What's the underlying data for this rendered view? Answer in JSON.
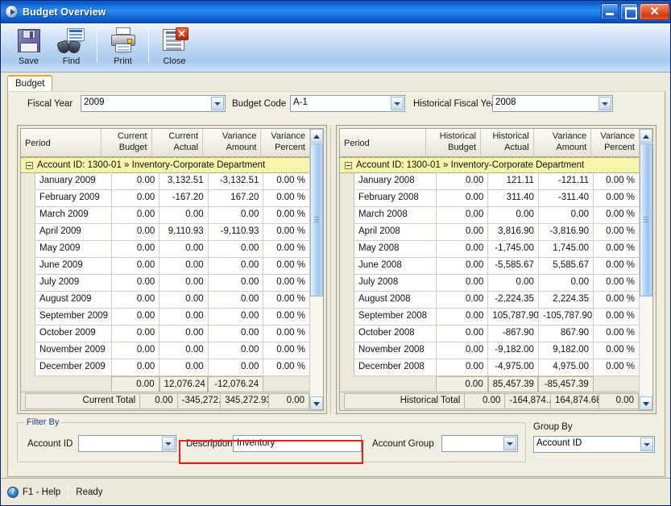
{
  "window": {
    "title": "Budget Overview",
    "icon": "play-circle-icon",
    "controls": {
      "minimize": "_",
      "maximize": "□",
      "close": "✕"
    }
  },
  "toolbar": {
    "items": [
      {
        "label": "Save",
        "icon": "floppy-disk-icon"
      },
      {
        "label": "Find",
        "icon": "binoculars-icon"
      },
      {
        "label": "Print",
        "icon": "printer-icon"
      },
      {
        "label": "Close",
        "icon": "close-window-icon"
      }
    ]
  },
  "tabs": [
    {
      "label": "Budget",
      "selected": true
    }
  ],
  "top_filters": {
    "fiscal_year": {
      "label": "Fiscal Year",
      "value": "2009"
    },
    "budget_code": {
      "label": "Budget Code",
      "value": "A-1"
    },
    "historical_fiscal_year": {
      "label": "Historical Fiscal Year",
      "value": "2008"
    }
  },
  "left_grid": {
    "columns": [
      "Period",
      "Current\nBudget",
      "Current\nActual",
      "Variance\nAmount",
      "Variance\nPercent"
    ],
    "columns_split": [
      {
        "l1": "Period",
        "l2": ""
      },
      {
        "l1": "Current",
        "l2": "Budget"
      },
      {
        "l1": "Current",
        "l2": "Actual"
      },
      {
        "l1": "Variance",
        "l2": "Amount"
      },
      {
        "l1": "Variance",
        "l2": "Percent"
      }
    ],
    "group_row": "Account ID: 1300-01 » Inventory-Corporate Department",
    "rows": [
      {
        "period": "January 2009",
        "budget": "0.00",
        "actual": "3,132.51",
        "variance": "-3,132.51",
        "percent": "0.00 %"
      },
      {
        "period": "February 2009",
        "budget": "0.00",
        "actual": "-167.20",
        "variance": "167.20",
        "percent": "0.00 %"
      },
      {
        "period": "March 2009",
        "budget": "0.00",
        "actual": "0.00",
        "variance": "0.00",
        "percent": "0.00 %"
      },
      {
        "period": "April 2009",
        "budget": "0.00",
        "actual": "9,110.93",
        "variance": "-9,110.93",
        "percent": "0.00 %"
      },
      {
        "period": "May 2009",
        "budget": "0.00",
        "actual": "0.00",
        "variance": "0.00",
        "percent": "0.00 %"
      },
      {
        "period": "June 2009",
        "budget": "0.00",
        "actual": "0.00",
        "variance": "0.00",
        "percent": "0.00 %"
      },
      {
        "period": "July 2009",
        "budget": "0.00",
        "actual": "0.00",
        "variance": "0.00",
        "percent": "0.00 %"
      },
      {
        "period": "August 2009",
        "budget": "0.00",
        "actual": "0.00",
        "variance": "0.00",
        "percent": "0.00 %"
      },
      {
        "period": "September 2009",
        "budget": "0.00",
        "actual": "0.00",
        "variance": "0.00",
        "percent": "0.00 %"
      },
      {
        "period": "October 2009",
        "budget": "0.00",
        "actual": "0.00",
        "variance": "0.00",
        "percent": "0.00 %"
      },
      {
        "period": "November 2009",
        "budget": "0.00",
        "actual": "0.00",
        "variance": "0.00",
        "percent": "0.00 %"
      },
      {
        "period": "December 2009",
        "budget": "0.00",
        "actual": "0.00",
        "variance": "0.00",
        "percent": "0.00 %"
      }
    ],
    "subtotal": {
      "budget": "0.00",
      "actual": "12,076.24",
      "variance": "-12,076.24",
      "percent": ""
    },
    "total": {
      "label": "Current Total",
      "budget": "0.00",
      "actual": "-345,272...",
      "variance": "345,272.93",
      "percent": "0.00"
    }
  },
  "right_grid": {
    "columns_split": [
      {
        "l1": "Period",
        "l2": ""
      },
      {
        "l1": "Historical",
        "l2": "Budget"
      },
      {
        "l1": "Historical",
        "l2": "Actual"
      },
      {
        "l1": "Variance",
        "l2": "Amount"
      },
      {
        "l1": "Variance",
        "l2": "Percent"
      }
    ],
    "group_row": "Account ID: 1300-01 » Inventory-Corporate Department",
    "rows": [
      {
        "period": "January 2008",
        "budget": "0.00",
        "actual": "121.11",
        "variance": "-121.11",
        "percent": "0.00 %"
      },
      {
        "period": "February 2008",
        "budget": "0.00",
        "actual": "311.40",
        "variance": "-311.40",
        "percent": "0.00 %"
      },
      {
        "period": "March 2008",
        "budget": "0.00",
        "actual": "0.00",
        "variance": "0.00",
        "percent": "0.00 %"
      },
      {
        "period": "April 2008",
        "budget": "0.00",
        "actual": "3,816.90",
        "variance": "-3,816.90",
        "percent": "0.00 %"
      },
      {
        "period": "May 2008",
        "budget": "0.00",
        "actual": "-1,745.00",
        "variance": "1,745.00",
        "percent": "0.00 %"
      },
      {
        "period": "June 2008",
        "budget": "0.00",
        "actual": "-5,585.67",
        "variance": "5,585.67",
        "percent": "0.00 %"
      },
      {
        "period": "July 2008",
        "budget": "0.00",
        "actual": "0.00",
        "variance": "0.00",
        "percent": "0.00 %"
      },
      {
        "period": "August 2008",
        "budget": "0.00",
        "actual": "-2,224.35",
        "variance": "2,224.35",
        "percent": "0.00 %"
      },
      {
        "period": "September 2008",
        "budget": "0.00",
        "actual": "105,787.90",
        "variance": "-105,787.90",
        "percent": "0.00 %"
      },
      {
        "period": "October 2008",
        "budget": "0.00",
        "actual": "-867.90",
        "variance": "867.90",
        "percent": "0.00 %"
      },
      {
        "period": "November 2008",
        "budget": "0.00",
        "actual": "-9,182.00",
        "variance": "9,182.00",
        "percent": "0.00 %"
      },
      {
        "period": "December 2008",
        "budget": "0.00",
        "actual": "-4,975.00",
        "variance": "4,975.00",
        "percent": "0.00 %"
      }
    ],
    "subtotal": {
      "budget": "0.00",
      "actual": "85,457.39",
      "variance": "-85,457.39",
      "percent": ""
    },
    "total": {
      "label": "Historical Total",
      "budget": "0.00",
      "actual": "-164,874....",
      "variance": "164,874.68",
      "percent": "0.00"
    }
  },
  "filter_by": {
    "title": "Filter By",
    "account_id": {
      "label": "Account ID",
      "value": ""
    },
    "description": {
      "label": "Description",
      "value": "Inventory",
      "highlighted": true
    },
    "account_group": {
      "label": "Account Group",
      "value": ""
    }
  },
  "group_by": {
    "title": "Group By",
    "value": "Account ID"
  },
  "statusbar": {
    "help": "F1 - Help",
    "help_icon": "question-mark-icon",
    "status": "Ready"
  },
  "colors": {
    "titlebar_blue": "#1772de",
    "group_row_yellow": "#f7f5ac",
    "highlight_red": "#ee1c1c",
    "tab_accent": "#e8a33d",
    "client_bg": "#ece9d8"
  }
}
